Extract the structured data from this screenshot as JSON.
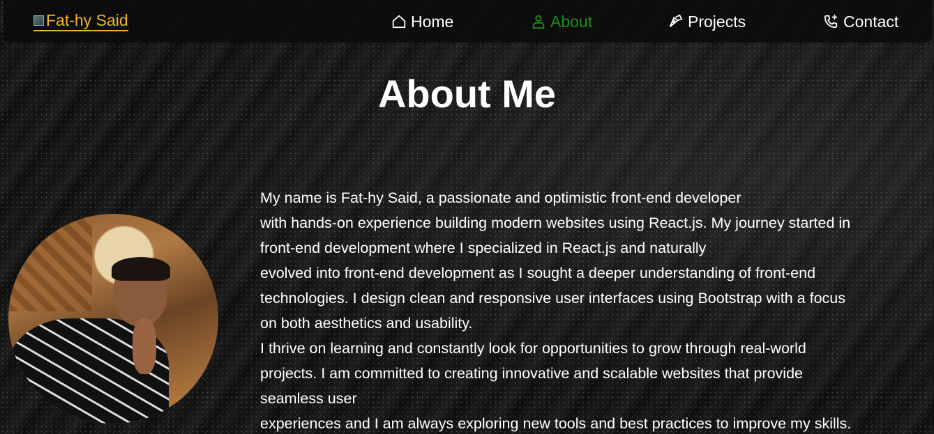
{
  "nav": {
    "brand": "Fat-hy Said",
    "items": [
      {
        "label": "Home",
        "icon": "home-icon"
      },
      {
        "label": "About",
        "icon": "user-icon",
        "active": true
      },
      {
        "label": "Projects",
        "icon": "pen-tool-icon"
      },
      {
        "label": "Contact",
        "icon": "phone-plus-icon"
      }
    ]
  },
  "main": {
    "title": "About Me",
    "bio_lines": [
      "My name is Fat-hy Said, a passionate and optimistic front-end developer",
      "with hands-on experience building modern websites using React.js. My journey started in",
      "front-end development where I specialized in React.js and naturally",
      "evolved into front-end development as I sought a deeper understanding of front-end",
      "technologies. I design clean and responsive user interfaces using Bootstrap with a focus",
      "on both aesthetics and usability.",
      "I thrive on learning and constantly look for opportunities to grow through real-world",
      "projects. I am committed to creating innovative and scalable websites that provide",
      "seamless user",
      "experiences and I am always exploring new tools and best practices to improve my skills."
    ]
  },
  "colors": {
    "brand": "#f0b429",
    "active_nav": "#1a8f1a",
    "text": "#ffffff",
    "background": "#111111"
  }
}
